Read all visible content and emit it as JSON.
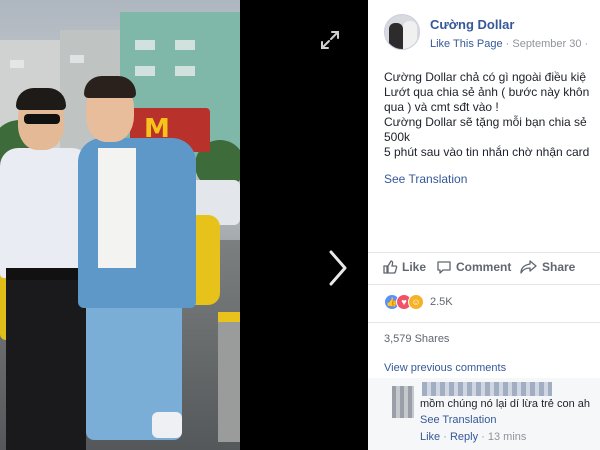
{
  "post": {
    "page_name": "Cường Dollar",
    "like_page": "Like This Page",
    "separator": " · ",
    "date": "September 30",
    "trailing_separator": " · ",
    "lines": [
      "Cường Dollar chả có gì ngoài điều kiệ",
      "Lướt qua chia sẻ ảnh ( bước này khôn",
      "qua ) và cmt sđt vào !",
      "Cường Dollar sẽ tặng mỗi bạn chia sẻ",
      "500k",
      "5 phút sau vào tin nhắn chờ nhận card"
    ],
    "see_translation": "See Translation"
  },
  "actions": {
    "like": "Like",
    "comment": "Comment",
    "share": "Share"
  },
  "reactions": {
    "count": "2.5K",
    "icons": [
      "like-icon",
      "love-icon",
      "haha-icon"
    ],
    "colors": {
      "like": "#5890ff",
      "love": "#f25268",
      "haha": "#f7b125"
    }
  },
  "shares": {
    "label": "3,579 Shares"
  },
  "comments": {
    "view_previous": "View previous comments",
    "items": [
      {
        "text": "mồm chúng nó lại dí lừa trẻ con ah",
        "see_translation": "See Translation",
        "like": "Like",
        "reply": "Reply",
        "time": "13 mins",
        "dot": " · "
      }
    ]
  },
  "viewer": {
    "expand_icon": "expand-icon",
    "next_icon": "chevron-right-icon"
  },
  "colors": {
    "link": "#365899",
    "meta": "#90949c",
    "background": "#000000"
  }
}
